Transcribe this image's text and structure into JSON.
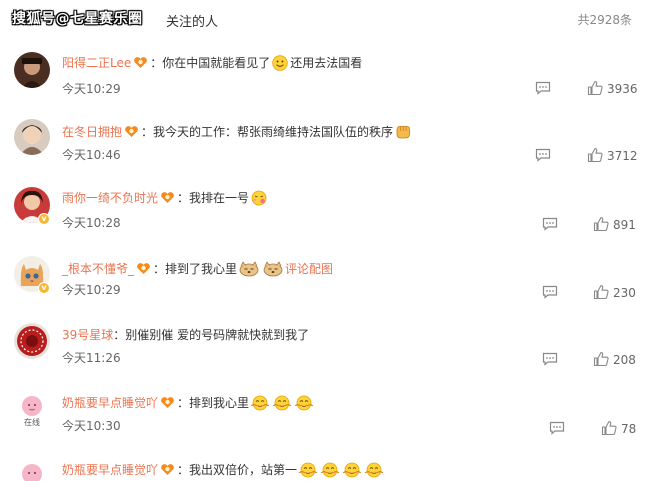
{
  "header": {
    "watermark": "搜狐号@七星赛乐圈",
    "tab": "关注的人",
    "total": "共2928条"
  },
  "comments": [
    {
      "user": "阳得二正Lee",
      "text": "你在中国就能看见了",
      "text2": "还用去法国看",
      "time": "今天10:29",
      "likes": "3936"
    },
    {
      "user": "在冬日拥抱",
      "text": "我今天的工作：帮张雨绮维持法国队伍的秩序",
      "time": "今天10:46",
      "likes": "3712"
    },
    {
      "user": "雨你一绮不负时光",
      "text": "我排在一号",
      "time": "今天10:28",
      "likes": "891"
    },
    {
      "user": "_根本不懂爷_",
      "text": "排到了我心里",
      "link": "评论配图",
      "time": "今天10:29",
      "likes": "230"
    },
    {
      "user": "39号星球",
      "text": "别催别催 爱的号码牌就快就到我了",
      "time": "今天11:26",
      "likes": "208"
    },
    {
      "user": "奶瓶要早点睡觉吖",
      "text": "排到我心里",
      "avatar_text": "在线",
      "time": "今天10:30",
      "likes": "78"
    },
    {
      "user": "奶瓶要早点睡觉吖",
      "text": "我出双倍价，站第一"
    }
  ]
}
